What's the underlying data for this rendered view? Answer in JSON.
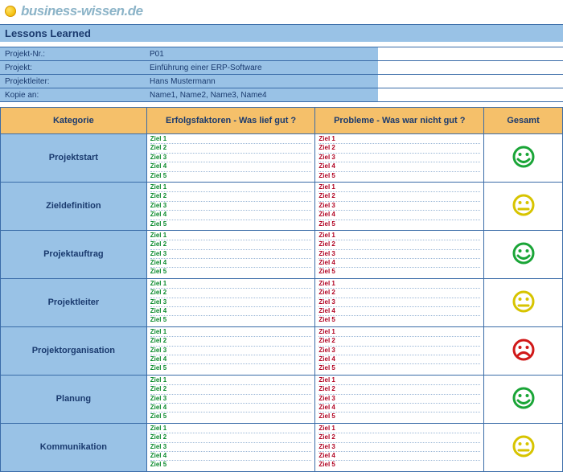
{
  "brand": "business-wissen.de",
  "title": "Lessons Learned",
  "meta": {
    "projectNrLabel": "Projekt-Nr.:",
    "projectNr": "P01",
    "projectLabel": "Projekt:",
    "project": "Einführung einer ERP-Software",
    "leaderLabel": "Projektleiter:",
    "leader": "Hans Mustermann",
    "copyLabel": "Kopie an:",
    "copy": "Name1, Name2, Name3, Name4"
  },
  "columns": {
    "kategorie": "Kategorie",
    "gut": "Erfolgsfaktoren - Was lief gut ?",
    "bad": "Probleme - Was war nicht gut ?",
    "gesamt": "Gesamt"
  },
  "ziele": [
    "Ziel 1",
    "Ziel 2",
    "Ziel 3",
    "Ziel 4",
    "Ziel 5"
  ],
  "rows": [
    {
      "cat": "Projektstart",
      "mood": "green"
    },
    {
      "cat": "Zieldefinition",
      "mood": "yellow"
    },
    {
      "cat": "Projektauftrag",
      "mood": "green"
    },
    {
      "cat": "Projektleiter",
      "mood": "yellow"
    },
    {
      "cat": "Projektorganisation",
      "mood": "red"
    },
    {
      "cat": "Planung",
      "mood": "green"
    },
    {
      "cat": "Kommunikation",
      "mood": "yellow"
    }
  ],
  "colors": {
    "green": "#1aa537",
    "yellow": "#d7c400",
    "red": "#d01818"
  }
}
